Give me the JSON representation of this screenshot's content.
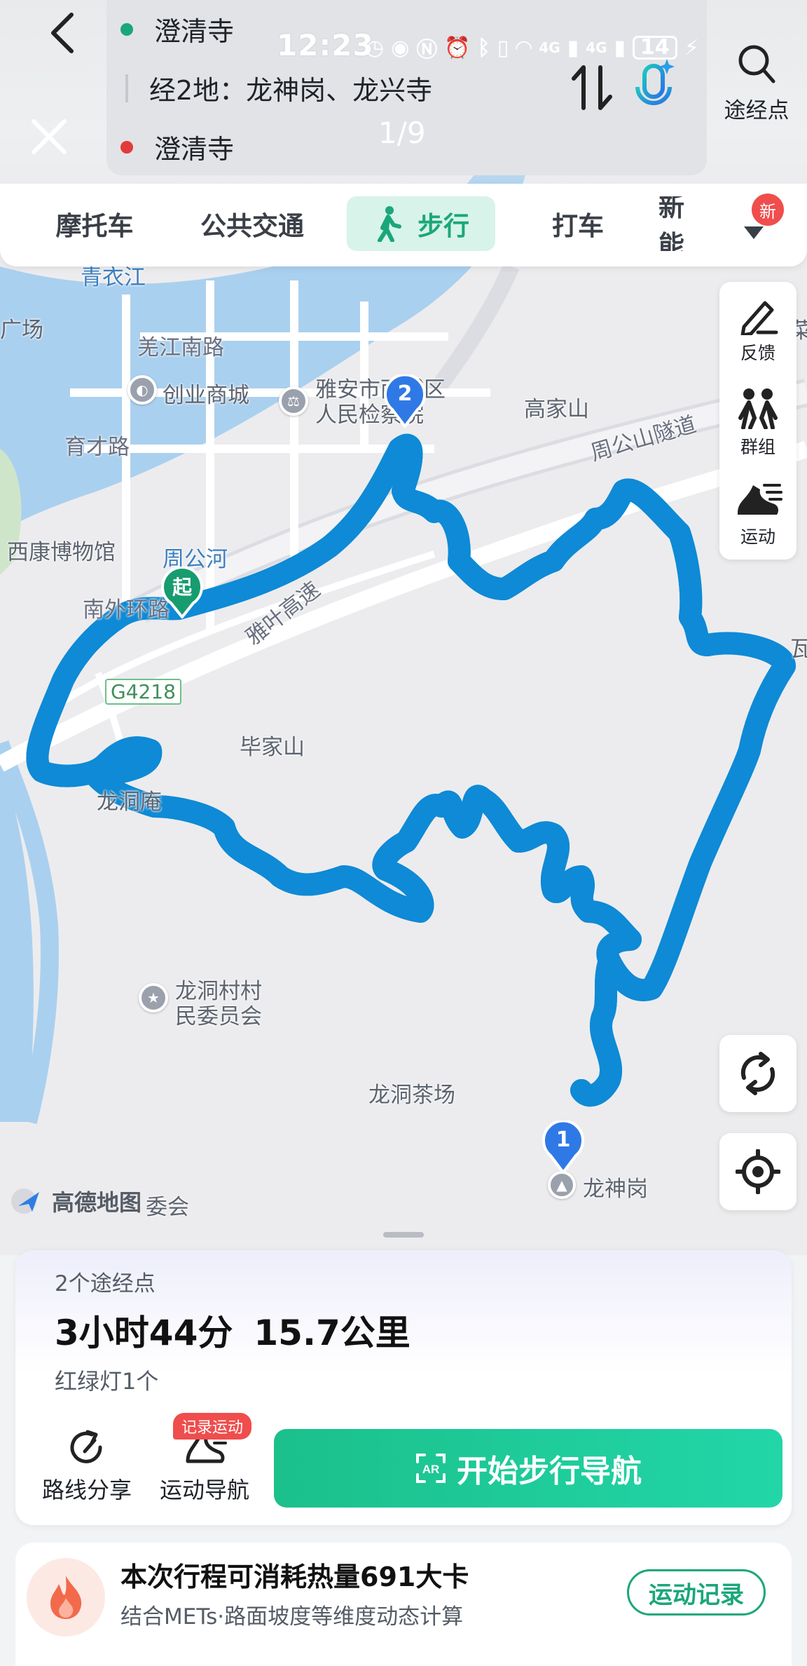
{
  "status_bar": {
    "time": "12:23",
    "battery": "14",
    "network": [
      "4G",
      "4G"
    ]
  },
  "route": {
    "start": "澄清寺",
    "via": "经2地：龙神岗、龙兴寺",
    "end": "澄清寺",
    "page_indicator": "1/9",
    "waypoint_button": "途经点"
  },
  "tabs": [
    {
      "label": "摩托车",
      "active": false
    },
    {
      "label": "公共交通",
      "active": false
    },
    {
      "label": "步行",
      "active": true
    },
    {
      "label": "打车",
      "active": false
    },
    {
      "label": "新能",
      "active": false
    }
  ],
  "tab_new_badge": "新",
  "tools": [
    {
      "label": "反馈",
      "icon": "pen-icon"
    },
    {
      "label": "群组",
      "icon": "group-icon"
    },
    {
      "label": "运动",
      "icon": "running-shoe-icon"
    }
  ],
  "map": {
    "labels": [
      {
        "text": "青衣江",
        "cls": "blue"
      },
      {
        "text": "广场",
        "cls": ""
      },
      {
        "text": "羌江南路",
        "cls": "road"
      },
      {
        "text": "创业商城",
        "cls": ""
      },
      {
        "text": "雅安市雨城区",
        "cls": ""
      },
      {
        "text": "人民检察院",
        "cls": ""
      },
      {
        "text": "高家山",
        "cls": ""
      },
      {
        "text": "周公山隧道",
        "cls": "road"
      },
      {
        "text": "育才路",
        "cls": "road"
      },
      {
        "text": "西康博物馆",
        "cls": ""
      },
      {
        "text": "周公河",
        "cls": "blue"
      },
      {
        "text": "南外环路",
        "cls": "road"
      },
      {
        "text": "雅叶高速",
        "cls": "road"
      },
      {
        "text": "G4218",
        "cls": "small"
      },
      {
        "text": "毕家山",
        "cls": ""
      },
      {
        "text": "龙洞庵",
        "cls": ""
      },
      {
        "text": "龙洞村村",
        "cls": ""
      },
      {
        "text": "民委员会",
        "cls": ""
      },
      {
        "text": "龙洞茶场",
        "cls": ""
      },
      {
        "text": "龙神岗",
        "cls": ""
      },
      {
        "text": "委会",
        "cls": ""
      },
      {
        "text": "瓦",
        "cls": ""
      },
      {
        "text": "菜",
        "cls": ""
      }
    ],
    "start_marker": "起",
    "waypoint_markers": [
      "1",
      "2"
    ],
    "logo": "高德地图",
    "route_color": "#29b4ec"
  },
  "summary": {
    "waypoint_count": "2个途经点",
    "duration": "3小时44分",
    "distance": "15.7公里",
    "traffic_lights": "红绿灯1个",
    "share_label": "路线分享",
    "sport_nav_label": "运动导航",
    "record_badge": "记录运动",
    "start_button": "开始步行导航"
  },
  "calorie": {
    "title": "本次行程可消耗热量691大卡",
    "description": "结合METs·路面坡度等维度动态计算",
    "record_button": "运动记录"
  },
  "colors": {
    "accent": "#1aa77a",
    "start_gradient": "#1bc08b",
    "badge": "#f04d4d"
  }
}
